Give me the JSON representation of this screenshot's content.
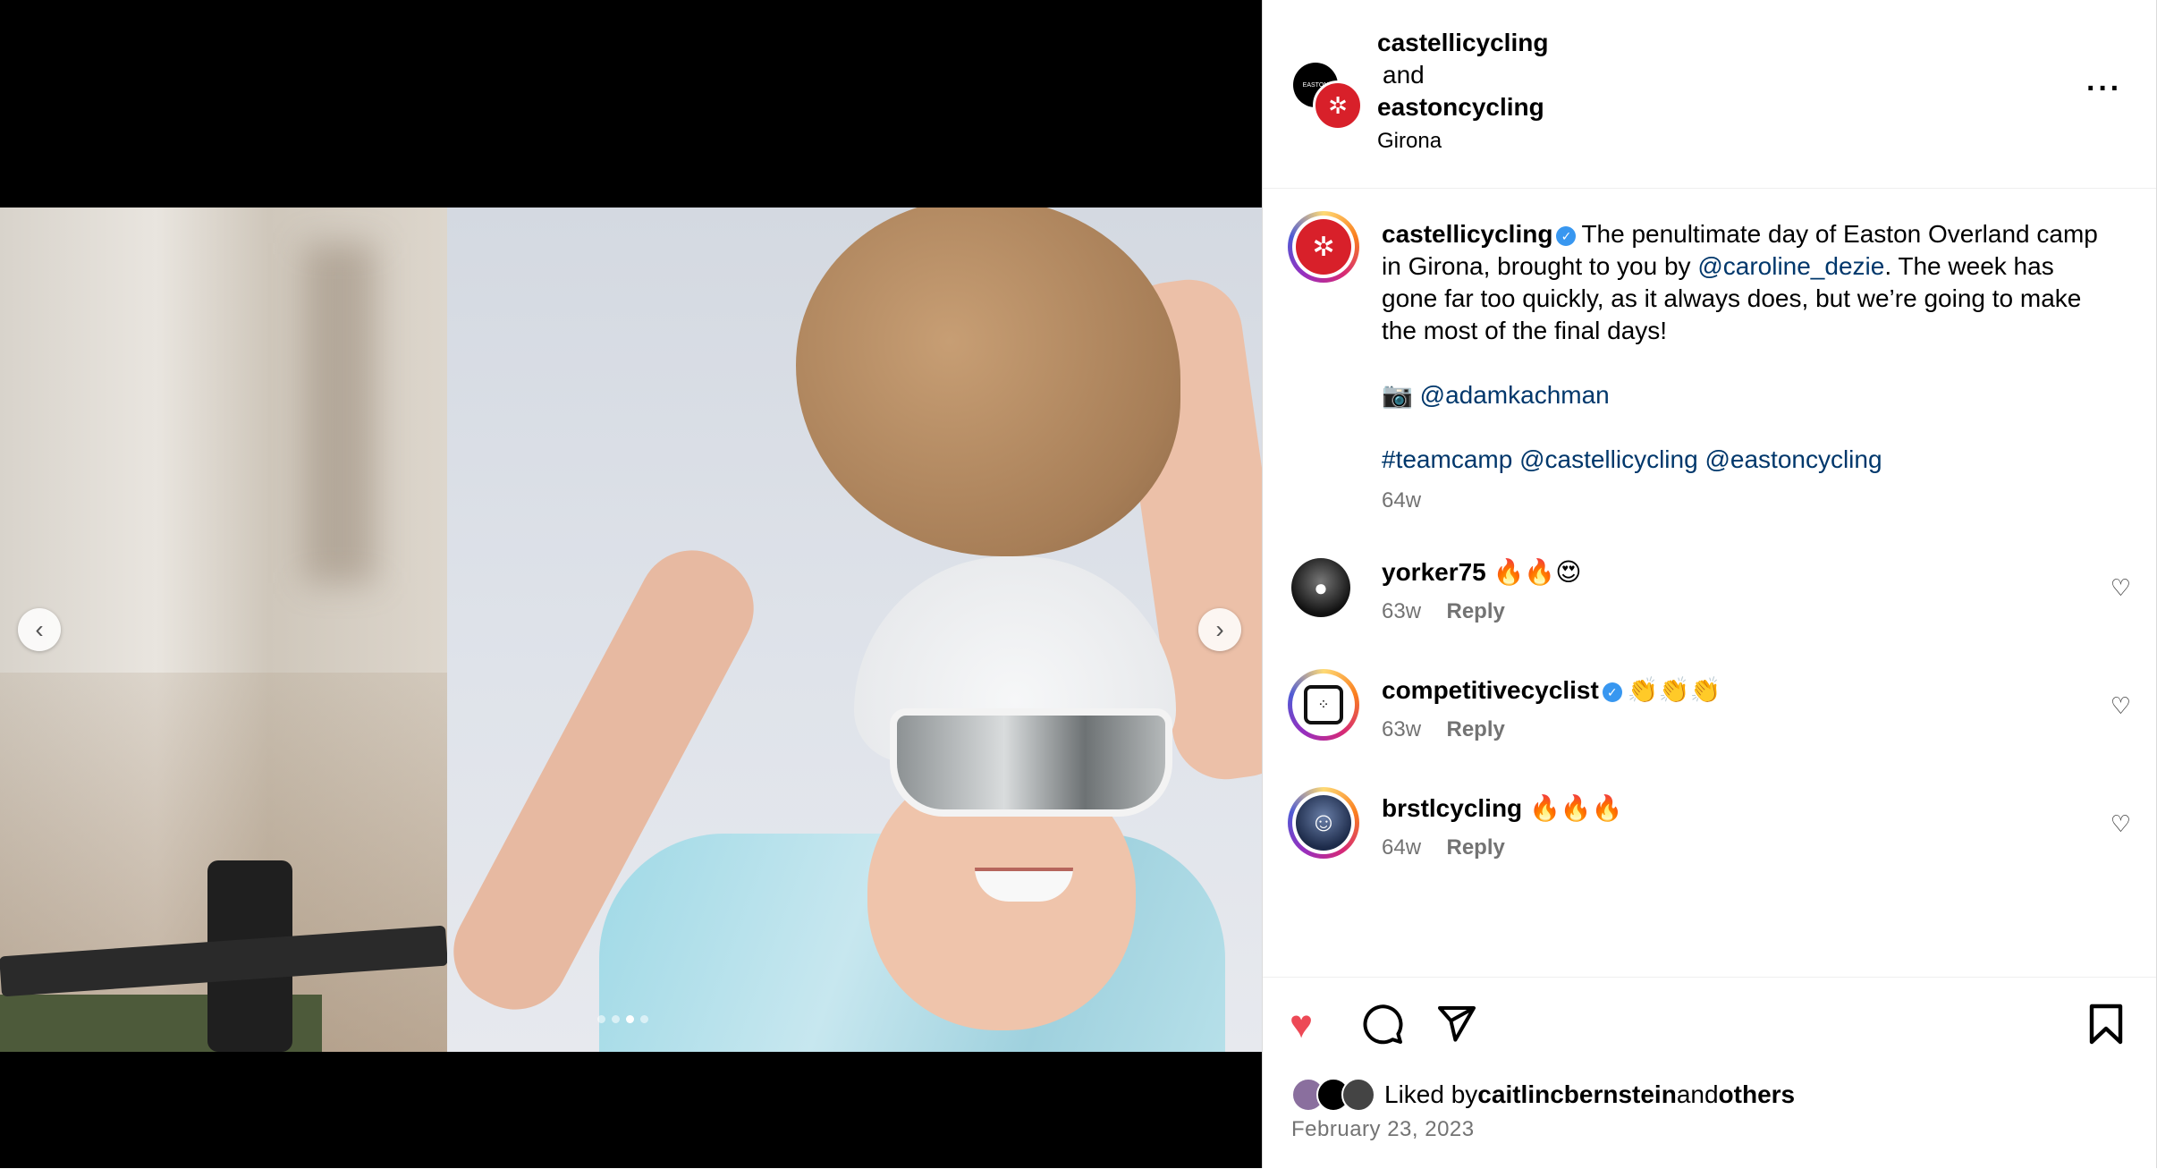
{
  "post": {
    "carousel": {
      "total": 4,
      "active_index": 2
    },
    "header": {
      "user1": "castellicycling",
      "connector": "and",
      "user2": "eastoncycling",
      "location": "Girona",
      "more_icon": "more-horizontal-icon",
      "avatar_black_text": "EASTON"
    },
    "caption": {
      "username": "castellicycling",
      "text_1": "The penultimate day of Easton Overland camp in Girona, brought to you by ",
      "mention_1": "@caroline_dezie",
      "text_2": ". The week has gone far too quickly, as it always does, but we’re going to make the most of the final days!",
      "camera_emoji": "📷",
      "mention_photographer": "@adamkachman",
      "hashtag": "#teamcamp",
      "mention_2": "@castellicycling",
      "mention_3": "@eastoncycling",
      "time": "64w"
    },
    "comments": [
      {
        "username": "yorker75",
        "text": "🔥🔥😍",
        "time": "63w",
        "reply": "Reply",
        "verified": false
      },
      {
        "username": "competitivecyclist",
        "text": "👏👏👏",
        "time": "63w",
        "reply": "Reply",
        "verified": true
      },
      {
        "username": "brstlcycling",
        "text": "🔥🔥🔥",
        "time": "64w",
        "reply": "Reply",
        "verified": false
      }
    ],
    "actions": {
      "like_color": "#ed4956",
      "liked_by_prefix": "Liked by ",
      "liked_by_user": "caitlincbernstein",
      "liked_by_and": " and ",
      "liked_by_others": "others",
      "date": "February 23, 2023"
    }
  }
}
